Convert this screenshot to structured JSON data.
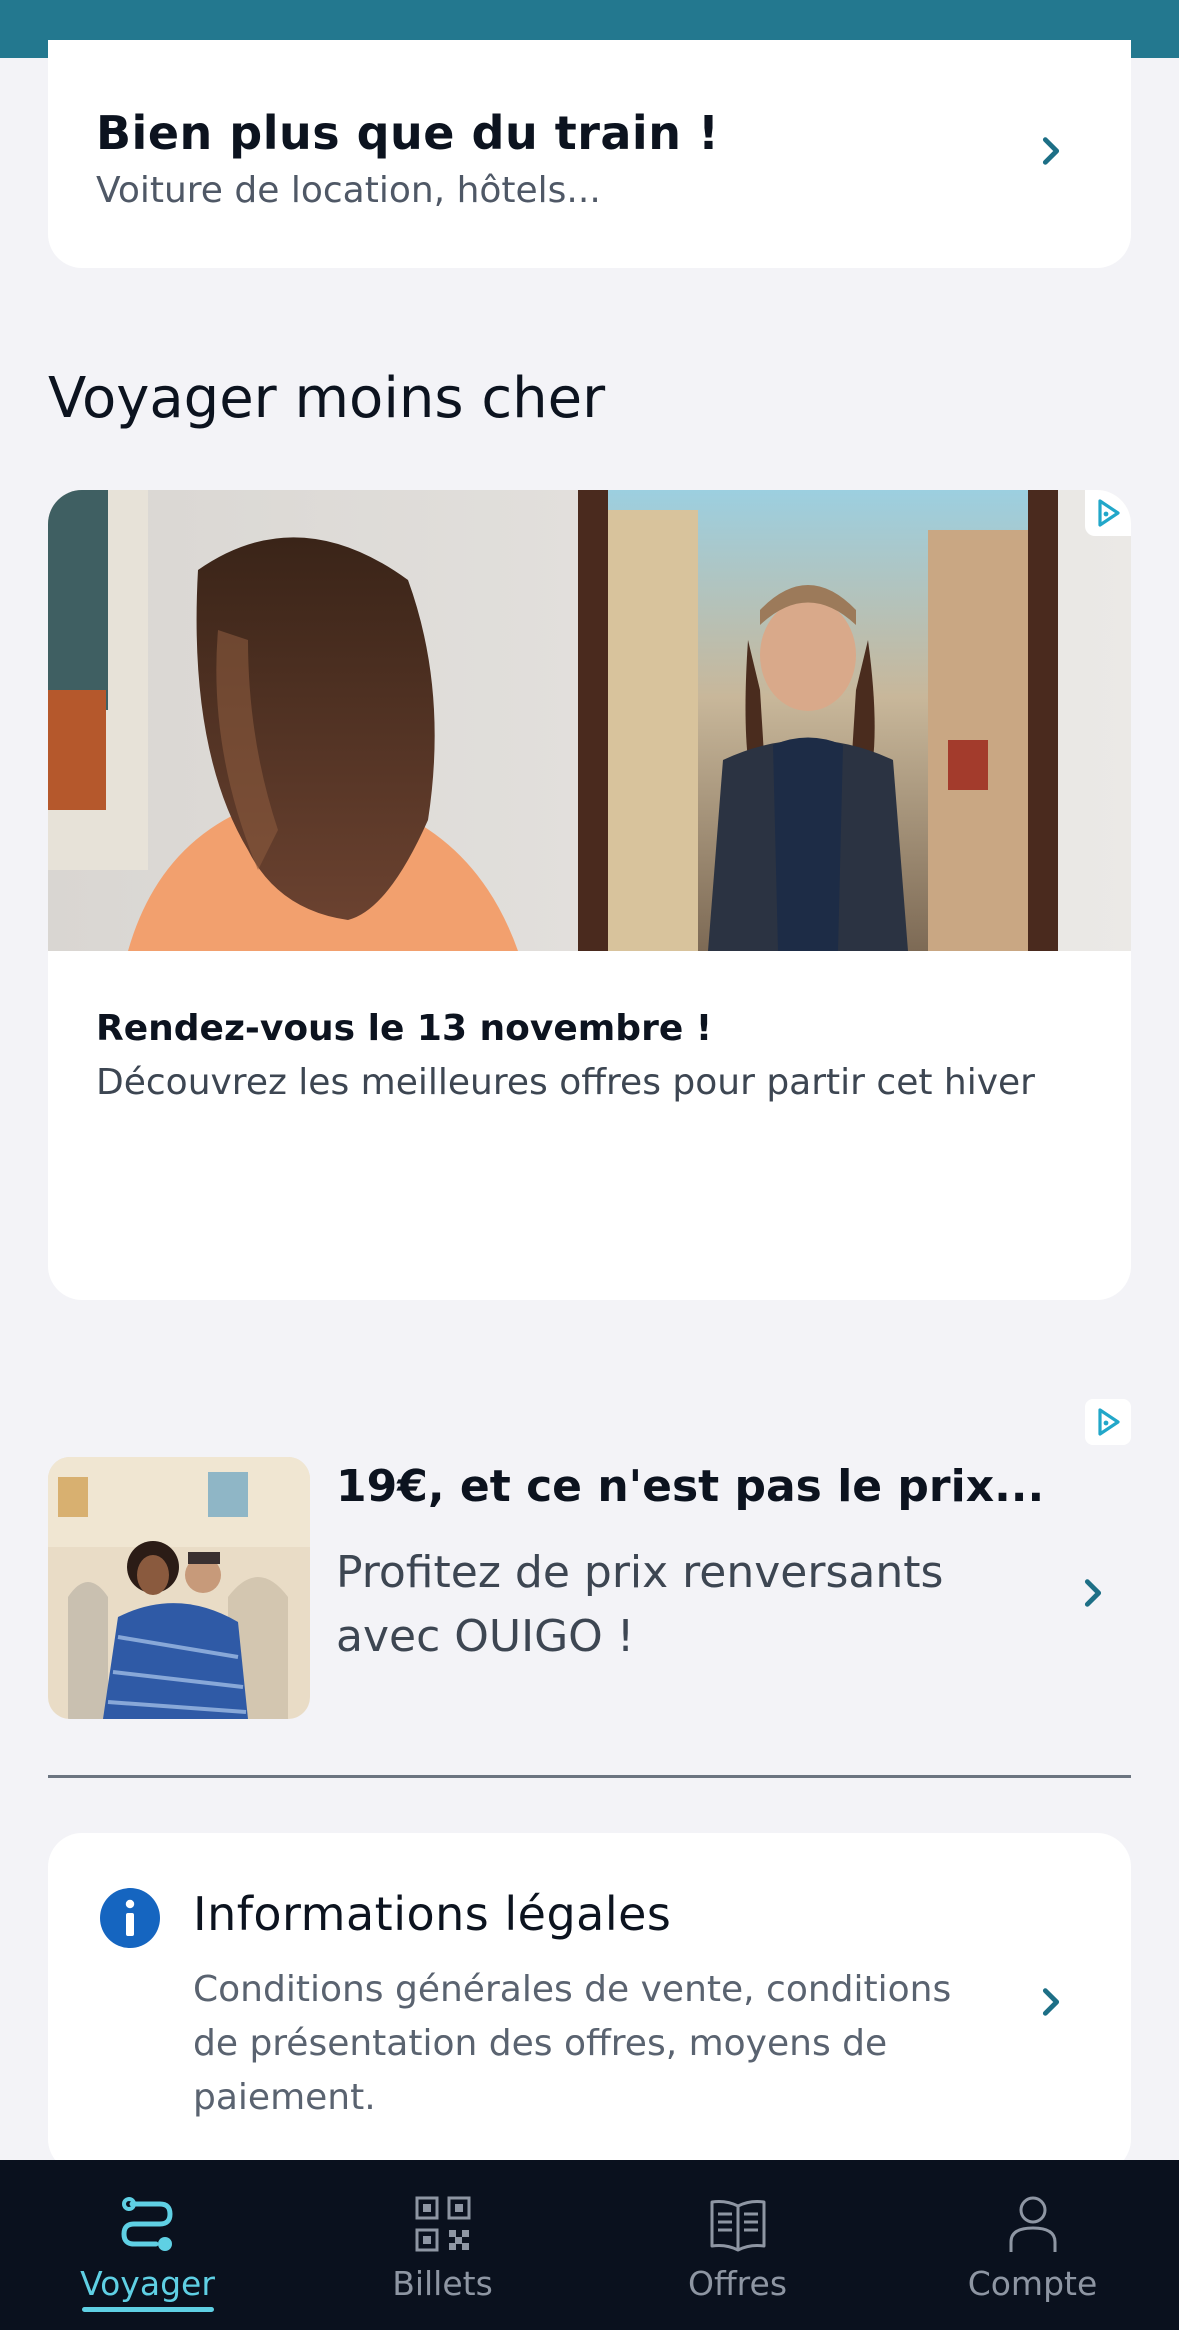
{
  "more_card": {
    "title": "Bien plus que du train !",
    "subtitle": "Voiture de location, hôtels..."
  },
  "section": {
    "title": "Voyager moins cher"
  },
  "ad_card": {
    "title": "Rendez-vous le 13 novembre !",
    "description": "Découvrez les meilleures offres pour partir cet hiver",
    "badge_icon": "adchoices-icon"
  },
  "promo": {
    "title": "19€, et ce n'est pas le prix...",
    "description": "Profitez de prix renversants avec OUIGO !",
    "badge_icon": "adchoices-icon"
  },
  "legal": {
    "title": "Informations légales",
    "description": "Conditions générales de vente, conditions de présentation des offres, moyens de paiement.",
    "icon": "info-icon"
  },
  "tabbar": {
    "tabs": [
      {
        "label": "Voyager",
        "icon": "route-icon",
        "active": true
      },
      {
        "label": "Billets",
        "icon": "qr-code-icon",
        "active": false
      },
      {
        "label": "Offres",
        "icon": "book-icon",
        "active": false
      },
      {
        "label": "Compte",
        "icon": "user-icon",
        "active": false
      }
    ]
  },
  "colors": {
    "status_bar": "#23788f",
    "accent": "#1d6f86",
    "tab_active": "#5fd0e4",
    "tabbar_bg": "#0a111e",
    "info_blue": "#1565c0"
  }
}
